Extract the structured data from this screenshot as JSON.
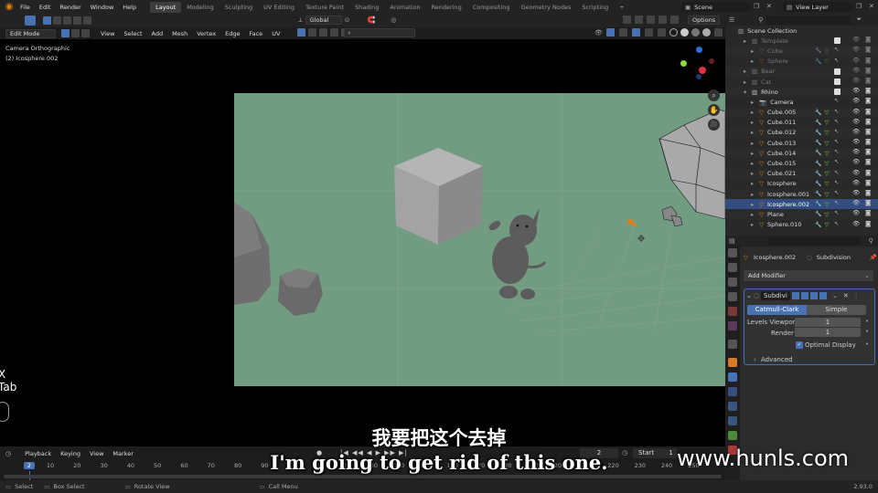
{
  "topbar": {
    "menus": [
      "File",
      "Edit",
      "Render",
      "Window",
      "Help"
    ],
    "workspaces": [
      "Layout",
      "Modeling",
      "Sculpting",
      "UV Editing",
      "Texture Paint",
      "Shading",
      "Animation",
      "Rendering",
      "Compositing",
      "Geometry Nodes",
      "Scripting"
    ],
    "active_workspace": "Layout",
    "add_tab": "+",
    "scene": "Scene",
    "view_layer": "View Layer"
  },
  "toolbar": {
    "transform_orientation": "Global",
    "options": "Options"
  },
  "header": {
    "mode": "Edit Mode",
    "menus": [
      "View",
      "Select",
      "Add",
      "Mesh",
      "Vertex",
      "Edge",
      "Face",
      "UV"
    ]
  },
  "viewport": {
    "camera_label": "Camera Orthographic",
    "object_label": "(2) Icosphere.002",
    "key_hint_1": "X",
    "key_hint_2": "Tab"
  },
  "outliner": {
    "title": "Scene Collection",
    "rows": [
      {
        "name": "Template",
        "dim": true,
        "indent": 1,
        "type": "collection"
      },
      {
        "name": "Cube",
        "dim": true,
        "indent": 2,
        "type": "mesh"
      },
      {
        "name": "Sphere",
        "dim": true,
        "indent": 2,
        "type": "mesh"
      },
      {
        "name": "Bear",
        "dim": true,
        "indent": 1,
        "type": "collection"
      },
      {
        "name": "Cat",
        "dim": true,
        "indent": 1,
        "type": "collection"
      },
      {
        "name": "Rhino",
        "dim": false,
        "indent": 1,
        "type": "collection"
      },
      {
        "name": "Camera",
        "dim": false,
        "indent": 2,
        "type": "camera"
      },
      {
        "name": "Cube.005",
        "dim": false,
        "indent": 2,
        "type": "mesh"
      },
      {
        "name": "Cube.011",
        "dim": false,
        "indent": 2,
        "type": "mesh"
      },
      {
        "name": "Cube.012",
        "dim": false,
        "indent": 2,
        "type": "mesh"
      },
      {
        "name": "Cube.013",
        "dim": false,
        "indent": 2,
        "type": "mesh"
      },
      {
        "name": "Cube.014",
        "dim": false,
        "indent": 2,
        "type": "mesh"
      },
      {
        "name": "Cube.015",
        "dim": false,
        "indent": 2,
        "type": "mesh"
      },
      {
        "name": "Cube.021",
        "dim": false,
        "indent": 2,
        "type": "mesh"
      },
      {
        "name": "Icosphere",
        "dim": false,
        "indent": 2,
        "type": "mesh"
      },
      {
        "name": "Icosphere.001",
        "dim": false,
        "indent": 2,
        "type": "mesh"
      },
      {
        "name": "Icosphere.002",
        "dim": false,
        "indent": 2,
        "type": "mesh",
        "selected": true
      },
      {
        "name": "Plane",
        "dim": false,
        "indent": 2,
        "type": "mesh"
      },
      {
        "name": "Sphere.010",
        "dim": false,
        "indent": 2,
        "type": "mesh"
      }
    ]
  },
  "properties": {
    "object_name": "Icosphere.002",
    "modifier_name": "Subdivision",
    "add_modifier": "Add Modifier",
    "mod_short": "Subdivi",
    "type_catmull": "Catmull-Clark",
    "type_simple": "Simple",
    "levels_viewport_label": "Levels Viewport",
    "levels_viewport_value": "1",
    "render_label": "Render",
    "render_value": "1",
    "optimal_display": "Optimal Display",
    "advanced": "Advanced"
  },
  "timeline": {
    "menus": [
      "Playback",
      "Keying",
      "View",
      "Marker"
    ],
    "current_frame": "2",
    "start_label": "Start",
    "start_value": "1",
    "ruler": [
      "2",
      "10",
      "20",
      "30",
      "40",
      "50",
      "60",
      "70",
      "80",
      "90",
      "100",
      "110",
      "120",
      "130",
      "140",
      "150",
      "160",
      "170",
      "180",
      "190",
      "200",
      "210",
      "220",
      "230",
      "240",
      "250"
    ]
  },
  "statusbar": {
    "select": "Select",
    "box_select": "Box Select",
    "rotate_view": "Rotate View",
    "call_menu": "Call Menu",
    "version": "2.93.0"
  },
  "subtitles": {
    "cn": "我要把这个去掉",
    "en": "I'm going to get rid of this one."
  },
  "watermark": "www.hunls.com",
  "colors": {
    "accent": "#4772b3",
    "camera_bg": "#719c82",
    "selected_row": "#334d80",
    "orange": "#e87d0d"
  }
}
